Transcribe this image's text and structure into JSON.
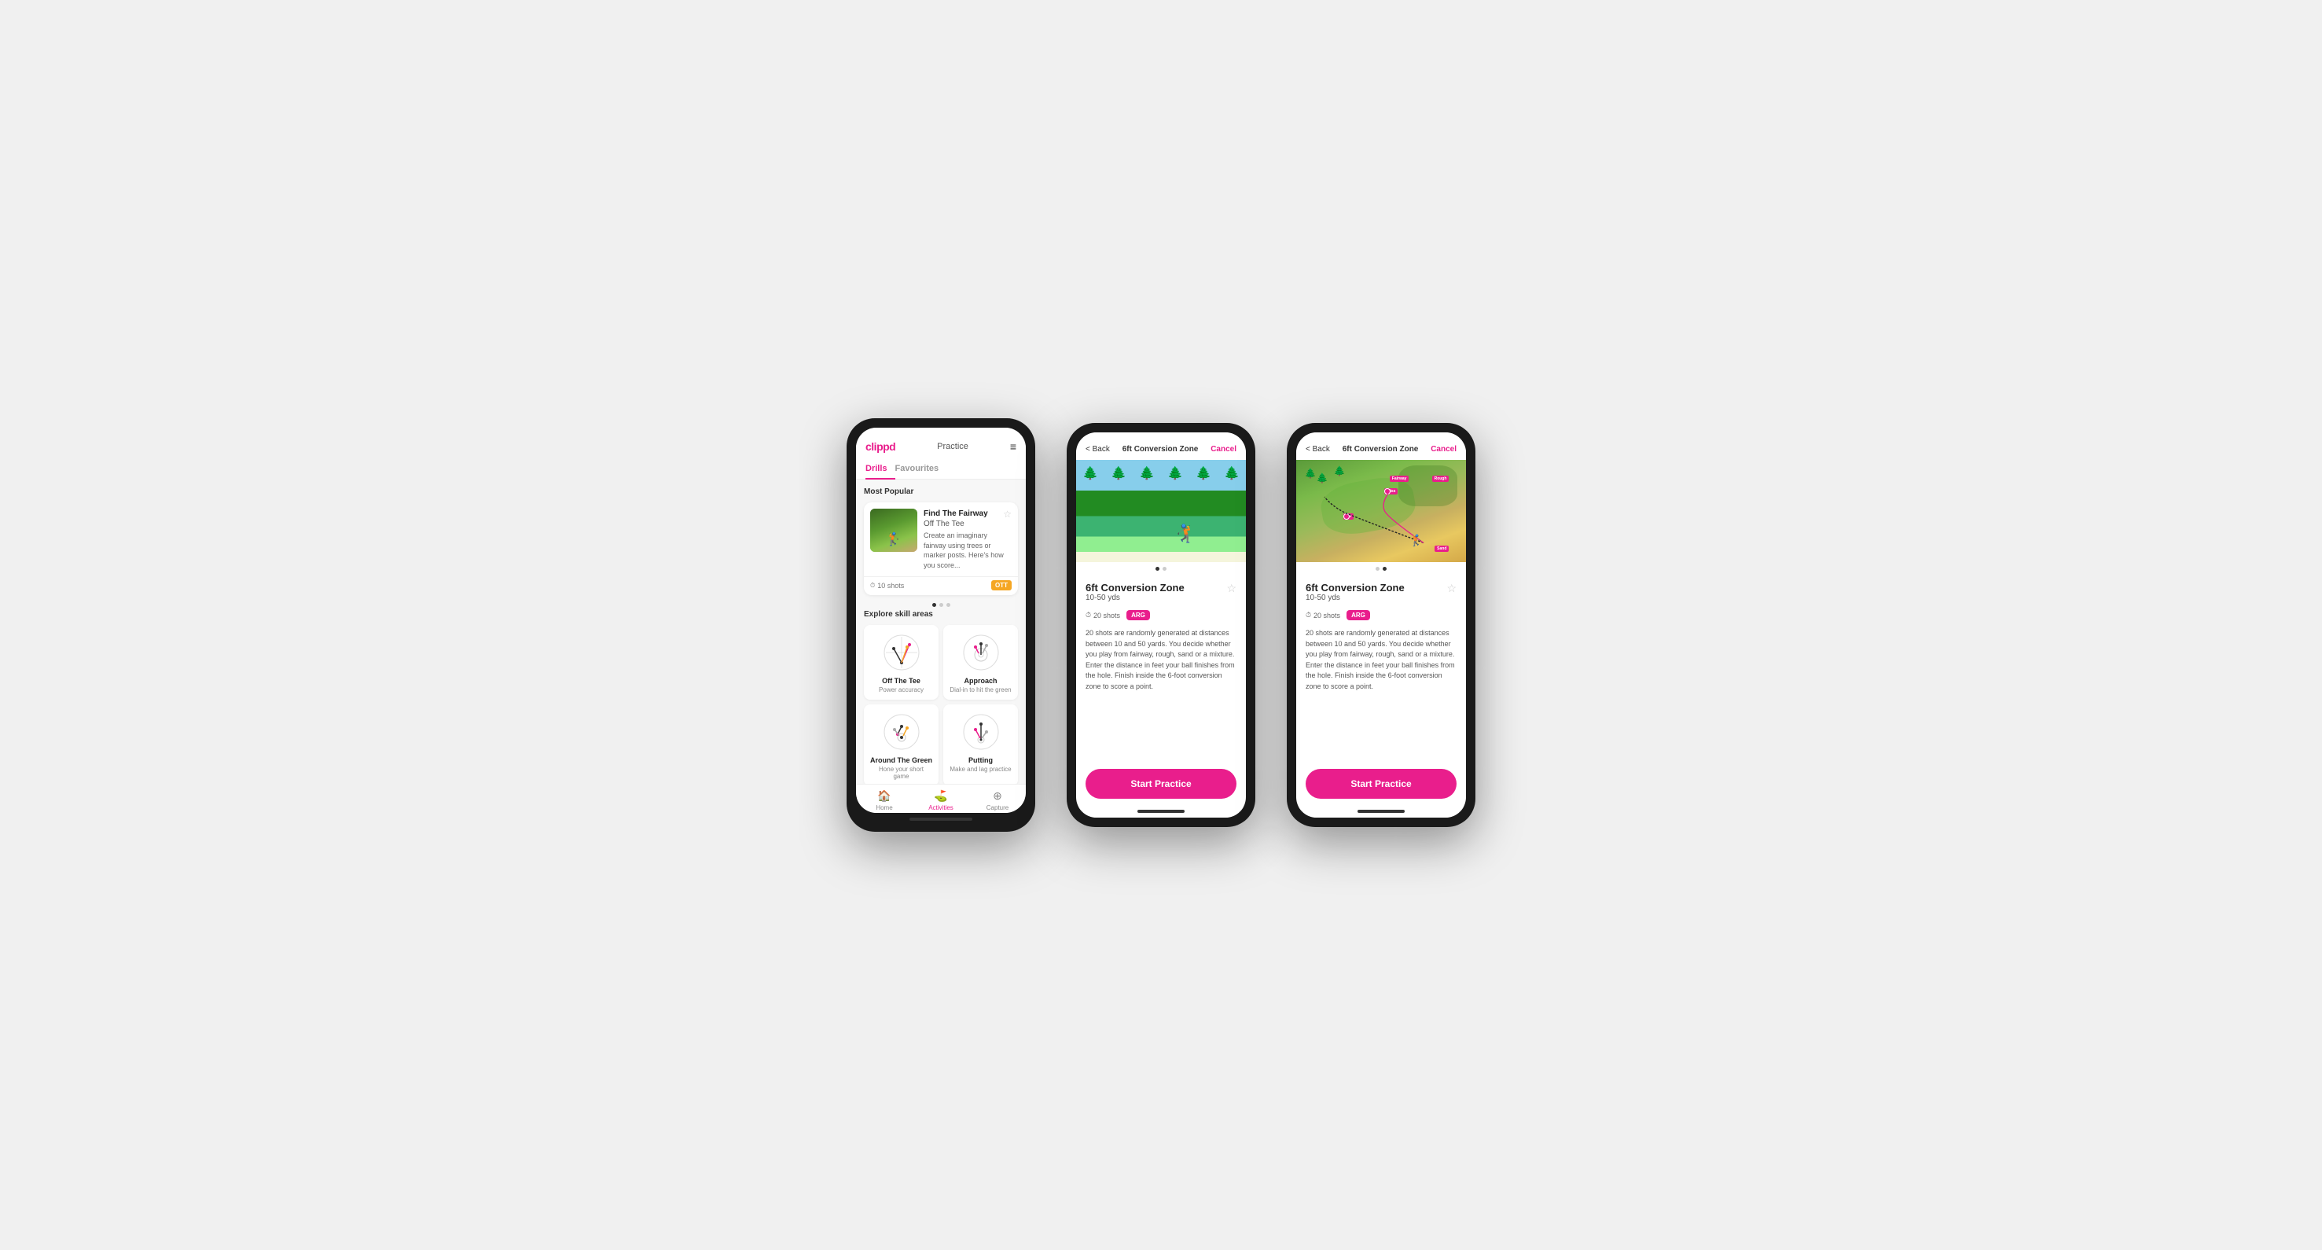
{
  "phones": [
    {
      "id": "phone1",
      "type": "app-list",
      "header": {
        "logo": "clippd",
        "nav_title": "Practice",
        "menu_icon": "≡"
      },
      "tabs": [
        {
          "label": "Drills",
          "active": true
        },
        {
          "label": "Favourites",
          "active": false
        }
      ],
      "most_popular_label": "Most Popular",
      "featured_drill": {
        "title": "Find The Fairway",
        "subtitle": "Off The Tee",
        "description": "Create an imaginary fairway using trees or marker posts. Here's how you score...",
        "shots": "10 shots",
        "tag": "OTT",
        "tag_class": "tag-ott"
      },
      "dots": [
        true,
        false,
        false
      ],
      "explore_label": "Explore skill areas",
      "skill_areas": [
        {
          "name": "Off The Tee",
          "desc": "Power accuracy",
          "icon": "ott"
        },
        {
          "name": "Approach",
          "desc": "Dial-in to hit the green",
          "icon": "approach"
        },
        {
          "name": "Around The Green",
          "desc": "Hone your short game",
          "icon": "atg"
        },
        {
          "name": "Putting",
          "desc": "Make and lag practice",
          "icon": "putting"
        }
      ],
      "bottom_nav": [
        {
          "icon": "🏠",
          "label": "Home",
          "active": false
        },
        {
          "icon": "⛳",
          "label": "Activities",
          "active": true
        },
        {
          "icon": "➕",
          "label": "Capture",
          "active": false
        }
      ]
    },
    {
      "id": "phone2",
      "type": "drill-detail-photo",
      "header": {
        "back_label": "< Back",
        "title": "6ft Conversion Zone",
        "cancel_label": "Cancel"
      },
      "image_dots": [
        true,
        false
      ],
      "drill": {
        "title": "6ft Conversion Zone",
        "range": "10-50 yds",
        "shots": "20 shots",
        "tag": "ARG",
        "description": "20 shots are randomly generated at distances between 10 and 50 yards. You decide whether you play from fairway, rough, sand or a mixture. Enter the distance in feet your ball finishes from the hole. Finish inside the 6-foot conversion zone to score a point.",
        "star": "☆"
      },
      "start_button_label": "Start Practice"
    },
    {
      "id": "phone3",
      "type": "drill-detail-map",
      "header": {
        "back_label": "< Back",
        "title": "6ft Conversion Zone",
        "cancel_label": "Cancel"
      },
      "image_dots": [
        false,
        true
      ],
      "drill": {
        "title": "6ft Conversion Zone",
        "range": "10-50 yds",
        "shots": "20 shots",
        "tag": "ARG",
        "description": "20 shots are randomly generated at distances between 10 and 50 yards. You decide whether you play from fairway, rough, sand or a mixture. Enter the distance in feet your ball finishes from the hole. Finish inside the 6-foot conversion zone to score a point.",
        "star": "☆"
      },
      "map_labels": {
        "fairway": "Fairway",
        "rough": "Rough",
        "sand": "Sand",
        "hit": "Hit",
        "miss": "Miss"
      },
      "start_button_label": "Start Practice"
    }
  ]
}
